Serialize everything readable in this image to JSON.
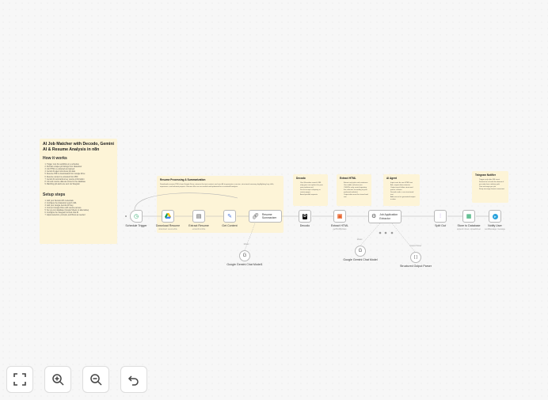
{
  "main_note": {
    "title": "AI Job Matcher with Decodo, Gemini AI & Resume Analysis in n8n",
    "how_heading": "How it works",
    "how_steps": [
      "Trigger runs the workflow on a schedule",
      "Decodo scrapes job listings from Glassdoor",
      "Job HTML is extracted and parsed",
      "Gemini AI agent structures job data",
      "Resume PDF is downloaded from Google Drive",
      "Resume content is extracted from PDF",
      "Gemini AI summarizes key resume information",
      "Job and resume data are stored in the database",
      "Matching job alerts are sent via Telegram"
    ],
    "setup_heading": "Setup steps",
    "setup_steps": [
      "Add your Decodo API credentials",
      "Configure the Glassdoor search URL",
      "Add your Google Gemini API key",
      "Connect Google Drive with resume access",
      "Set up your database (Google Sheets or alternative)",
      "Configure the Telegram bot and chat ID",
      "Adjust selectors, prompts, and filters as needed"
    ]
  },
  "notes": {
    "resume": {
      "title": "Resume Processing & Summarization",
      "body": "Downloads resume PDFs from Google Drive, extracts the text content, and uses AI to generate a concise, structured summary highlighting key skills, experience, and relevant projects. Ensures files are accessible and optimized for accurate AI analysis."
    },
    "decodo": {
      "title": "Decodo",
      "items": [
        "Use Glassdoor search URL only (you can replace for your own preferences)",
        "Do not scrape company or review pages",
        "Avoid parallel requests"
      ]
    },
    "extract": {
      "title": "Extract HTML",
      "items": [
        "Extract only job card containers",
        "Use stable selectors (no CSS/IDs only, avoid repeating the selectors according to your preferred website)",
        "Output data must be stored and one"
      ]
    },
    "ai_agent": {
      "title": "AI Agent",
      "items": [
        "Input must be raw HTML text",
        "Ask, expert data extractor",
        "Output must follow structured parser schema",
        "Decode code = use structured text",
        "Add source for generated output in data"
      ]
    },
    "telegram": {
      "title": "Telegram Notifier",
      "items": [
        "Trigger only after DB insert",
        "Format the url with the domain if you only have relative path",
        "One message per job",
        "Keep message format consistent"
      ]
    }
  },
  "nodes": {
    "schedule": {
      "label": "Schedule Trigger"
    },
    "download_resume": {
      "label": "Download Resume",
      "sub": "download: resumeFile"
    },
    "extract_resume": {
      "label": "Extract Resume",
      "sub": "extractFromFile"
    },
    "get_content": {
      "label": "Get Content"
    },
    "resume_summarizer": {
      "label": "Resume Summarizer"
    },
    "decodo": {
      "label": "Decodo"
    },
    "extract_html": {
      "label": "Extract HTML",
      "sub": "getHtmlByClass"
    },
    "job_extractor": {
      "label": "Job Application Extractor"
    },
    "split_out": {
      "label": "Split Out"
    },
    "store_db": {
      "label": "Store to Database",
      "sub": "append: sheet, spreadsheet"
    },
    "notify_user": {
      "label": "Notify User",
      "sub": "sendMessage: message"
    },
    "gemini_1": {
      "label": "Google Gemini Chat Model1",
      "conn": "Model"
    },
    "gemini_2": {
      "label": "Google Gemini Chat Model",
      "conn": "Model"
    },
    "parser": {
      "label": "Structured Output Parser",
      "conn": "Output Parser"
    }
  },
  "controls": {
    "fit": "fit-view-icon",
    "zoom_in": "zoom-in-icon",
    "zoom_out": "zoom-out-icon",
    "undo": "undo-icon"
  }
}
